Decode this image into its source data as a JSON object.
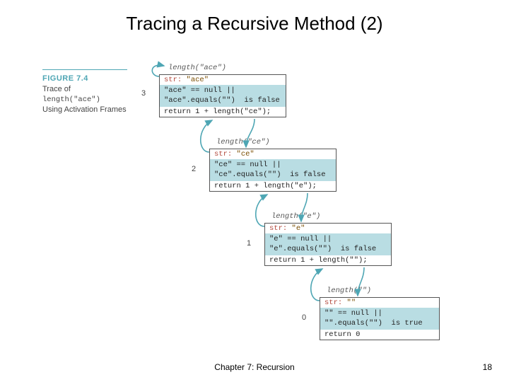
{
  "title": "Tracing a Recursive Method (2)",
  "footer": {
    "chapter": "Chapter 7: Recursion",
    "page": "18"
  },
  "figure": {
    "label": "FIGURE 7.4",
    "cap1": "Trace of",
    "cap2": "length(\"ace\")",
    "cap3": "Using Activation Frames"
  },
  "returns": {
    "r1": "3",
    "r2": "2",
    "r3": "1",
    "r4": "0"
  },
  "calls": {
    "c1": "length(\"ace\")",
    "c2": "length(\"ce\")",
    "c3": "length(\"e\")",
    "c4": "length(\"\")"
  },
  "frames": {
    "f1": {
      "strlabel": "str:",
      "strval": " \"ace\"",
      "cond1": "\"ace\" == null ||",
      "cond2": "\"ace\".equals(\"\")  is false",
      "ret": "return 1 + length(\"ce\");"
    },
    "f2": {
      "strlabel": "str:",
      "strval": " \"ce\"",
      "cond1": "\"ce\" == null ||",
      "cond2": "\"ce\".equals(\"\")  is false",
      "ret": "return 1 + length(\"e\");"
    },
    "f3": {
      "strlabel": "str:",
      "strval": " \"e\"",
      "cond1": "\"e\" == null ||",
      "cond2": "\"e\".equals(\"\")  is false",
      "ret": "return 1 + length(\"\");"
    },
    "f4": {
      "strlabel": "str:",
      "strval": " \"\"",
      "cond1": "\"\" == null ||",
      "cond2": "\"\".equals(\"\")  is true",
      "ret": "return 0"
    }
  }
}
